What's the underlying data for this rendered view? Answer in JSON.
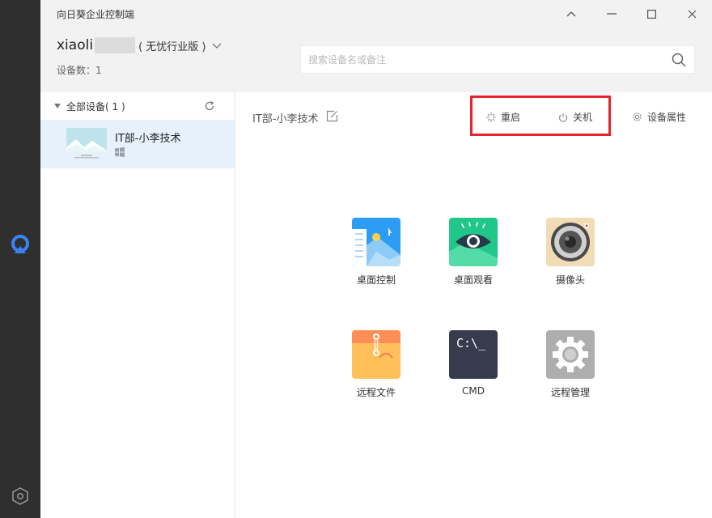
{
  "app": {
    "title": "向日葵企业控制端"
  },
  "window_controls": [
    "collapse-icon",
    "minimize-icon",
    "maximize-icon",
    "close-icon"
  ],
  "account": {
    "name": "xiaoli",
    "edition": "( 无忧行业版 )",
    "device_count_label": "设备数：1"
  },
  "search": {
    "placeholder": "搜索设备名或备注"
  },
  "sidebar": {
    "group_label": "全部设备( 1 )",
    "devices": [
      {
        "name": "IT部-小李技术",
        "os": "windows-icon"
      }
    ]
  },
  "main": {
    "device_title": "IT部-小李技术",
    "actions": {
      "restart": "重启",
      "shutdown": "关机",
      "properties": "设备属性"
    },
    "features": [
      {
        "key": "desktop-control",
        "label": "桌面控制"
      },
      {
        "key": "desktop-view",
        "label": "桌面观看"
      },
      {
        "key": "camera",
        "label": "摄像头"
      },
      {
        "key": "remote-file",
        "label": "远程文件"
      },
      {
        "key": "cmd",
        "label": "CMD",
        "tile_text": "C:\\_"
      },
      {
        "key": "remote-manage",
        "label": "远程管理"
      }
    ]
  },
  "colors": {
    "rail": "#2f2f2f",
    "accent": "#2f7bf5",
    "highlight": "#e3262d",
    "selected_row": "#e6f1fc"
  }
}
